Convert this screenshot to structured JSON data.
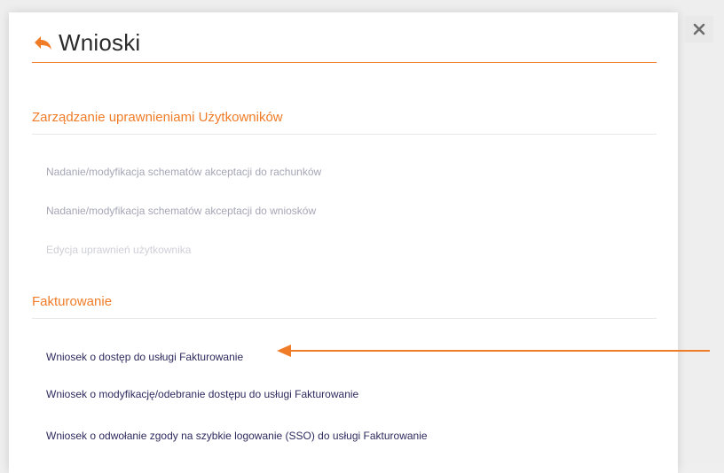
{
  "dialog": {
    "title": "Wnioski",
    "accent_color": "#f07c28"
  },
  "sections": [
    {
      "title": "Zarządzanie uprawnieniami Użytkowników",
      "items": [
        {
          "label": "Nadanie/modyfikacja schematów akceptacji do rachunków",
          "state": "muted"
        },
        {
          "label": "Nadanie/modyfikacja schematów akceptacji do wniosków",
          "state": "muted"
        },
        {
          "label": "Edycja uprawnień użytkownika",
          "state": "faint"
        }
      ]
    },
    {
      "title": "Fakturowanie",
      "items": [
        {
          "label": "Wniosek o dostęp do usługi Fakturowanie",
          "state": "active"
        },
        {
          "label": "Wniosek o modyfikację/odebranie dostępu do usługi Fakturowanie",
          "state": "active"
        },
        {
          "label": "Wniosek o odwołanie zgody na szybkie logowanie (SSO) do usługi Fakturowanie",
          "state": "active"
        }
      ]
    }
  ],
  "icons": {
    "back": "arrow-back-icon",
    "close": "close-icon",
    "annotation": "arrow-left-annotation"
  }
}
